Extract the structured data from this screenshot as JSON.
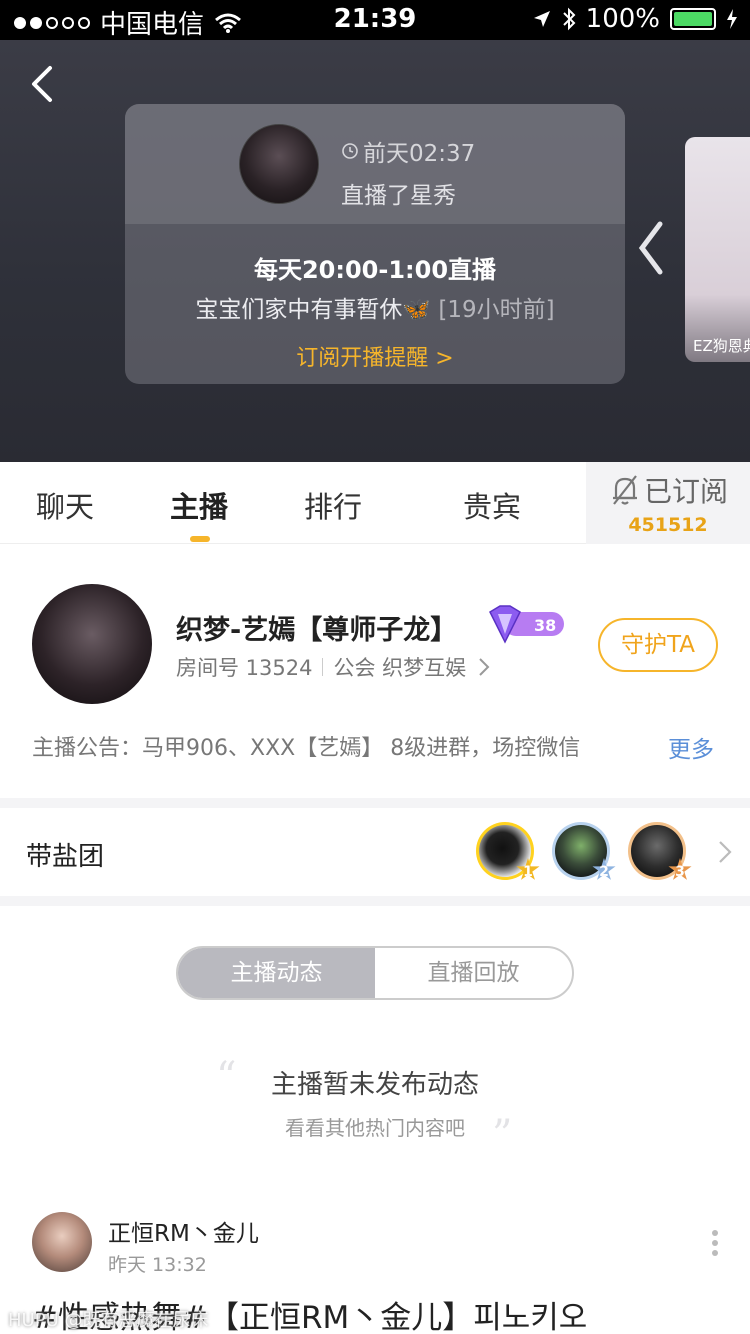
{
  "status_bar": {
    "carrier": "中国电信",
    "time": "21:39",
    "battery": "100%"
  },
  "hero": {
    "card": {
      "time": "前天02:37",
      "action": "直播了星秀",
      "schedule": "每天20:00-1:00直播",
      "note": "宝宝们家中有事暂休🦋",
      "note_ago": "[19小时前]",
      "subscribe_link": "订阅开播提醒 >"
    },
    "side_card_label": "EZ狗恩典"
  },
  "tabs": {
    "items": [
      "聊天",
      "主播",
      "排行",
      "贵宾"
    ],
    "active": "主播",
    "subscribed_label": "已订阅",
    "subscriber_count": "451512"
  },
  "anchor": {
    "name": "织梦-艺嫣【尊师子龙】",
    "level": "38",
    "room_label": "房间号 13524",
    "guild_label": "公会 织梦互娱",
    "guard_button": "守护TA",
    "notice": "主播公告：马甲906、XXX【艺嫣】 8级进群，场控微信",
    "more": "更多"
  },
  "salt_group": {
    "label": "带盐团",
    "ranks": [
      "1",
      "2",
      "3"
    ]
  },
  "segment": {
    "items": [
      "主播动态",
      "直播回放"
    ],
    "active": "主播动态"
  },
  "empty_state": {
    "title": "主播暂未发布动态",
    "subtitle": "看看其他热门内容吧"
  },
  "post": {
    "author": "正恒RM丶金儿",
    "time": "昨天 13:32",
    "text": "#性感热舞#【正恒RM丶金儿】피노키오"
  },
  "watermark": "HUPU @既有恶魔在尿床",
  "colors": {
    "accent": "#f6b52b",
    "link": "#5b8fd8",
    "battery": "#4cd964"
  }
}
